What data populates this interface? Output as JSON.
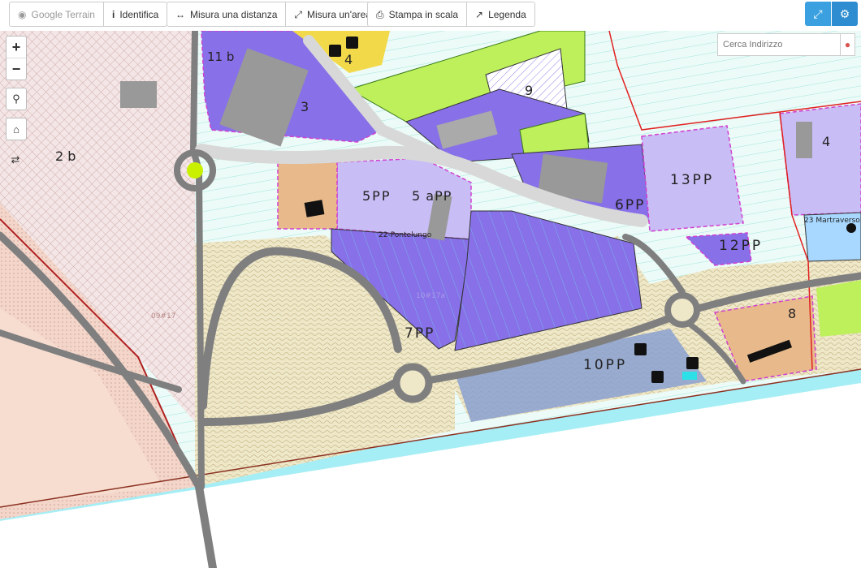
{
  "toolbar": {
    "google_terrain": "Google Terrain",
    "identifica": "Identifica",
    "misura_distanza": "Misura una distanza",
    "misura_area": "Misura un'area",
    "stampa": "Stampa in scala",
    "legenda": "Legenda"
  },
  "search": {
    "placeholder": "Cerca Indirizzo"
  },
  "map": {
    "zones": {
      "z11b": "11 b",
      "z3": "3",
      "z4top": "4",
      "z9": "9",
      "z2b": "2 b",
      "z5pp": "5PP",
      "z5app": "5 aPP",
      "z13pp": "13PP",
      "z6pp": "6PP",
      "z4right": "4",
      "z12pp": "12PP",
      "z7pp": "7PP",
      "z10pp": "10PP",
      "z8": "8"
    },
    "labels": {
      "pontelungo": "22-Pontelungo",
      "martraverso": "23 Martraverso",
      "code1017a": "10#17a",
      "code0917": "09#17"
    }
  },
  "colors": {
    "purple": "#8870e8",
    "light_purple": "#c9bdf5",
    "hatch_pink": "#e7cfcf",
    "green": "#bdf05a",
    "orange": "#e8b98a",
    "road": "#7f7f7f",
    "cyan": "#9ee8f2",
    "accent": "#3aa0e0"
  }
}
